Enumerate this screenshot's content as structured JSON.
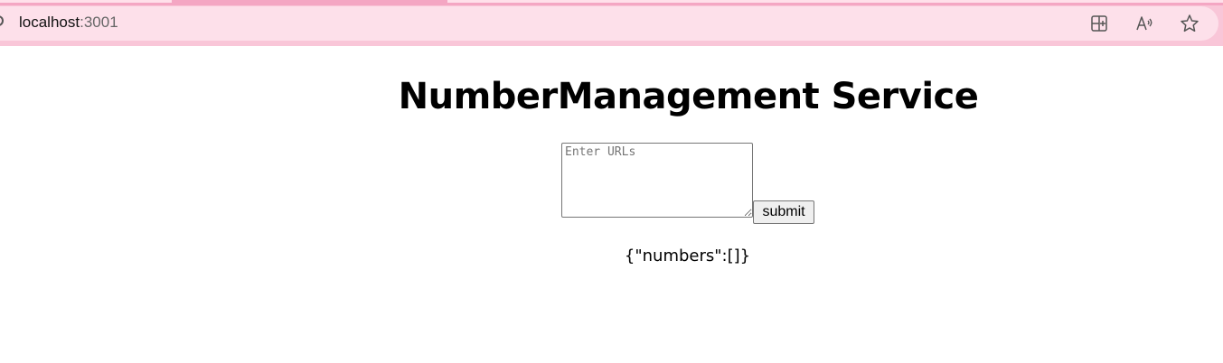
{
  "browser": {
    "address": {
      "host": "localhost",
      "port": ":3001"
    },
    "icons": [
      "split-screen-icon",
      "read-aloud-icon",
      "favorite-star-icon"
    ],
    "colors": {
      "chrome_bg": "#f9c6d8",
      "tab_strip": "#f4a6c3",
      "address_bg": "#fde0ea"
    }
  },
  "page": {
    "title": "NumberManagement Service",
    "url_input": {
      "placeholder": "Enter URLs",
      "value": ""
    },
    "submit_label": "submit",
    "result": "{\"numbers\":[]}"
  }
}
